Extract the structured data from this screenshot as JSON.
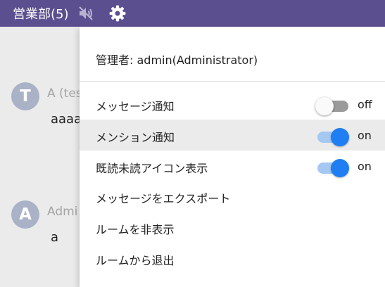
{
  "topbar": {
    "room_name": "営業部(5)",
    "icons": [
      "mute-icon",
      "gear-icon"
    ],
    "background": "#5b4f8f"
  },
  "messages": [
    {
      "avatar_letter": "T",
      "sender": "A (tes",
      "text": "aaaa"
    },
    {
      "avatar_letter": "A",
      "sender": "Admi",
      "text": "a"
    }
  ],
  "menu": {
    "admin_label": "管理者: admin(Administrator)",
    "items": [
      {
        "label": "メッセージ通知",
        "toggle": "off",
        "state_label": "off"
      },
      {
        "label": "メンション通知",
        "toggle": "on",
        "state_label": "on",
        "highlighted": true
      },
      {
        "label": "既読未読アイコン表示",
        "toggle": "on",
        "state_label": "on"
      },
      {
        "label": "メッセージをエクスポート"
      },
      {
        "label": "ルームを非表示"
      },
      {
        "label": "ルームから退出"
      }
    ]
  },
  "colors": {
    "accent": "#1e7ef2",
    "toggle_on_track": "#a4c8f2",
    "toggle_off_track": "#9b9b9b",
    "avatar": "#a9b2c6"
  }
}
